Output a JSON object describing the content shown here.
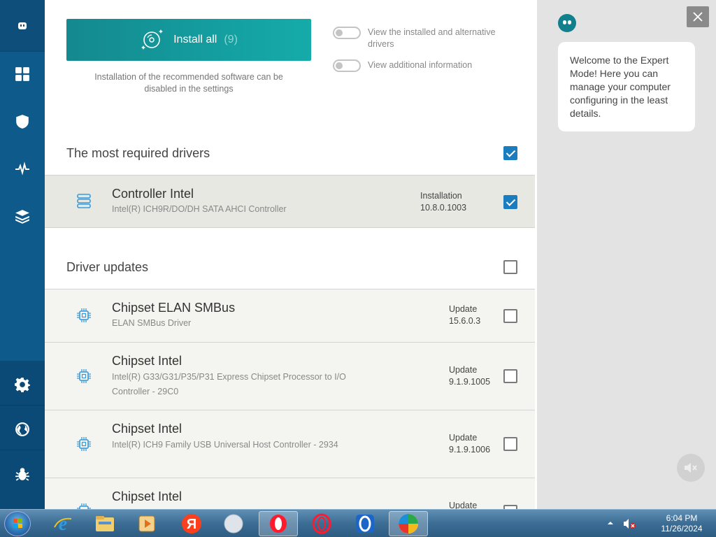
{
  "sidebar": {
    "logo_icon": "robot-face-icon",
    "items": [
      "dashboard-grid-icon",
      "shield-icon",
      "pulse-icon",
      "layers-icon"
    ],
    "bottom_items": [
      "gear-icon",
      "globe-icon",
      "bug-icon"
    ]
  },
  "top": {
    "install_label": "Install all",
    "install_count": "(9)",
    "install_note": "Installation of the recommended software can be disabled in the settings",
    "toggle1_label": "View the installed and alternative drivers",
    "toggle2_label": "View additional information"
  },
  "sections": {
    "required_title": "The most required drivers",
    "required_checked": true,
    "updates_title": "Driver updates",
    "updates_checked": false
  },
  "required_rows": [
    {
      "title": "Controller Intel",
      "subtitle": "Intel(R) ICH9R/DO/DH SATA AHCI Controller",
      "status": "Installation",
      "version": "10.8.0.1003",
      "checked": true,
      "icon": "storage-stack-icon"
    }
  ],
  "update_rows": [
    {
      "title": "Chipset ELAN SMBus",
      "subtitle": "ELAN SMBus Driver",
      "status": "Update",
      "version": "15.6.0.3",
      "checked": false,
      "icon": "chip-icon"
    },
    {
      "title": "Chipset Intel",
      "subtitle": "Intel(R) G33/G31/P35/P31 Express Chipset Processor to I/O Controller - 29C0",
      "status": "Update",
      "version": "9.1.9.1005",
      "checked": false,
      "icon": "chip-icon"
    },
    {
      "title": "Chipset Intel",
      "subtitle": "Intel(R) ICH9 Family USB Universal Host Controller - 2934",
      "status": "Update",
      "version": "9.1.9.1006",
      "checked": false,
      "icon": "chip-icon"
    },
    {
      "title": "Chipset Intel",
      "subtitle": "",
      "status": "Update",
      "version": "",
      "checked": false,
      "icon": "chip-icon"
    }
  ],
  "assistant": {
    "message": "Welcome to the Expert Mode! Here you can manage your computer configuring in the least details."
  },
  "taskbar": {
    "apps": [
      "internet-explorer-icon",
      "file-explorer-icon",
      "media-player-icon",
      "yandex-browser-icon",
      "app-orb-icon",
      "opera-icon",
      "opera-gx-icon",
      "opera-blue-icon",
      "driverpack-icon"
    ],
    "time": "6:04 PM",
    "date": "11/26/2024"
  },
  "colors": {
    "sidebar": "#0e5a8a",
    "accent": "#15aba9",
    "checkbox": "#1a7dbf"
  }
}
